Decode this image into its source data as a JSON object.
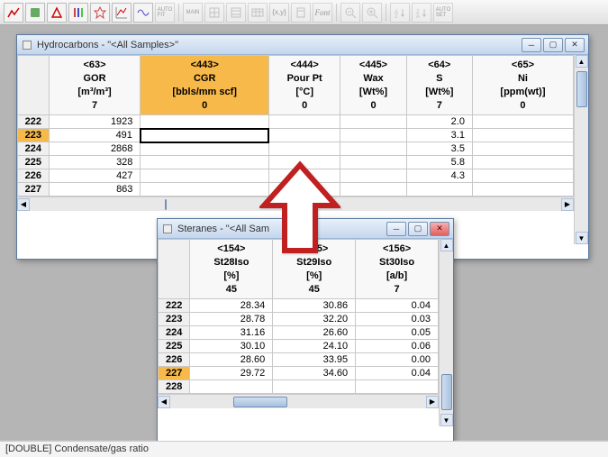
{
  "toolbar": [
    "chart-line",
    "chart-bar",
    "eq",
    "bars",
    "star",
    "line2",
    "wave",
    "auto",
    "main",
    "grid1",
    "grid2",
    "table",
    "xy",
    "clip",
    "font",
    "zoom-out",
    "zoom-in",
    "sort-asc",
    "sort-desc",
    "auto2"
  ],
  "win1": {
    "title": "Hydrocarbons - \"<All Samples>\"",
    "headers": [
      {
        "id": "<63>",
        "name": "GOR",
        "unit": "[m³/m³]",
        "val": "7"
      },
      {
        "id": "<443>",
        "name": "CGR",
        "unit": "[bbls/mm scf]",
        "val": "0",
        "sel": true
      },
      {
        "id": "<444>",
        "name": "Pour Pt",
        "unit": "[°C]",
        "val": "0"
      },
      {
        "id": "<445>",
        "name": "Wax",
        "unit": "[Wt%]",
        "val": "0"
      },
      {
        "id": "<64>",
        "name": "S",
        "unit": "[Wt%]",
        "val": "7"
      },
      {
        "id": "<65>",
        "name": "Ni",
        "unit": "[ppm(wt)]",
        "val": "0"
      }
    ],
    "rows": [
      {
        "hdr": "222",
        "gor": "1923",
        "s": "2.0"
      },
      {
        "hdr": "223",
        "gor": "491",
        "s": "3.1",
        "sel": true
      },
      {
        "hdr": "224",
        "gor": "2868",
        "s": "3.5"
      },
      {
        "hdr": "225",
        "gor": "328",
        "s": "5.8"
      },
      {
        "hdr": "226",
        "gor": "427",
        "s": "4.3"
      },
      {
        "hdr": "227",
        "gor": "863",
        "s": ""
      }
    ]
  },
  "win2": {
    "title": "Steranes - \"<All Sam",
    "headers": [
      {
        "id": "<154>",
        "name": "St28Iso",
        "unit": "[%]",
        "val": "45"
      },
      {
        "id": "<155>",
        "name": "St29Iso",
        "unit": "[%]",
        "val": "45"
      },
      {
        "id": "<156>",
        "name": "St30Iso",
        "unit": "[a/b]",
        "val": "7"
      }
    ],
    "rows": [
      {
        "hdr": "222",
        "c1": "28.34",
        "c2": "30.86",
        "c3": "0.04"
      },
      {
        "hdr": "223",
        "c1": "28.78",
        "c2": "32.20",
        "c3": "0.03"
      },
      {
        "hdr": "224",
        "c1": "31.16",
        "c2": "26.60",
        "c3": "0.05"
      },
      {
        "hdr": "225",
        "c1": "30.10",
        "c2": "24.10",
        "c3": "0.06"
      },
      {
        "hdr": "226",
        "c1": "28.60",
        "c2": "33.95",
        "c3": "0.00"
      },
      {
        "hdr": "227",
        "c1": "29.72",
        "c2": "34.60",
        "c3": "0.04",
        "sel": true
      },
      {
        "hdr": "228"
      }
    ]
  },
  "status": "[DOUBLE] Condensate/gas ratio"
}
